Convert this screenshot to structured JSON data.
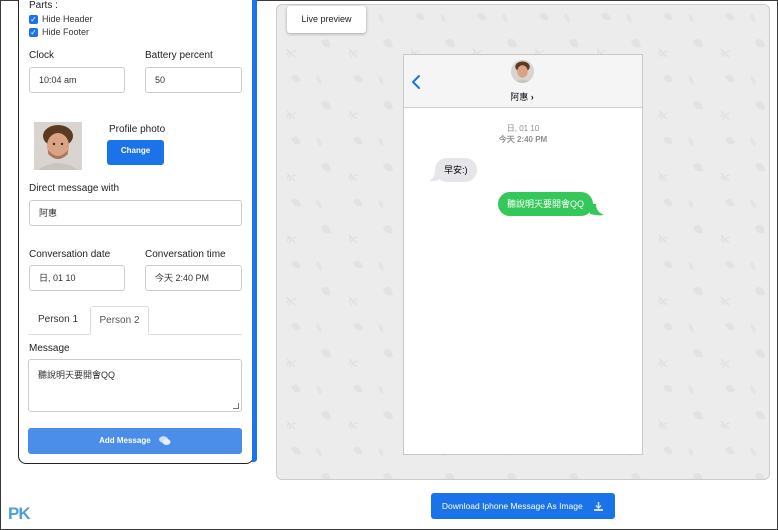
{
  "form": {
    "parts_label": "Parts :",
    "hide_header_label": "Hide Header",
    "hide_header_checked": true,
    "hide_footer_label": "Hide Footer",
    "hide_footer_checked": true,
    "clock_label": "Clock",
    "clock_value": "10:04 am",
    "battery_label": "Battery percent",
    "battery_value": "50",
    "profile_photo_label": "Profile photo",
    "change_button": "Change",
    "dm_label": "Direct message with",
    "dm_value": "阿惠",
    "conv_date_label": "Conversation date",
    "conv_date_value": "日, 01 10",
    "conv_time_label": "Conversation time",
    "conv_time_value": "今天 2:40 PM",
    "tabs": [
      {
        "label": "Person 1",
        "active": false
      },
      {
        "label": "Person 2",
        "active": true
      }
    ],
    "message_label": "Message",
    "message_value": "聽說明天要開會QQ",
    "add_message_button": "Add Message"
  },
  "preview": {
    "live_preview_button": "Live preview",
    "contact_name": "阿惠",
    "date_line": "日, 01 10",
    "time_line": "今天 2:40 PM",
    "messages": [
      {
        "side": "left",
        "text": "早安:)"
      },
      {
        "side": "right",
        "text": "聽說明天要開會QQ"
      }
    ]
  },
  "download_button": "Download Iphone Message As Image",
  "logo_text": "PK",
  "colors": {
    "primary": "#1a73e8",
    "add_button": "#4a8eea",
    "incoming_bubble": "#e5e5ea",
    "outgoing_bubble": "#34c759",
    "preview_bg": "#ececec"
  }
}
